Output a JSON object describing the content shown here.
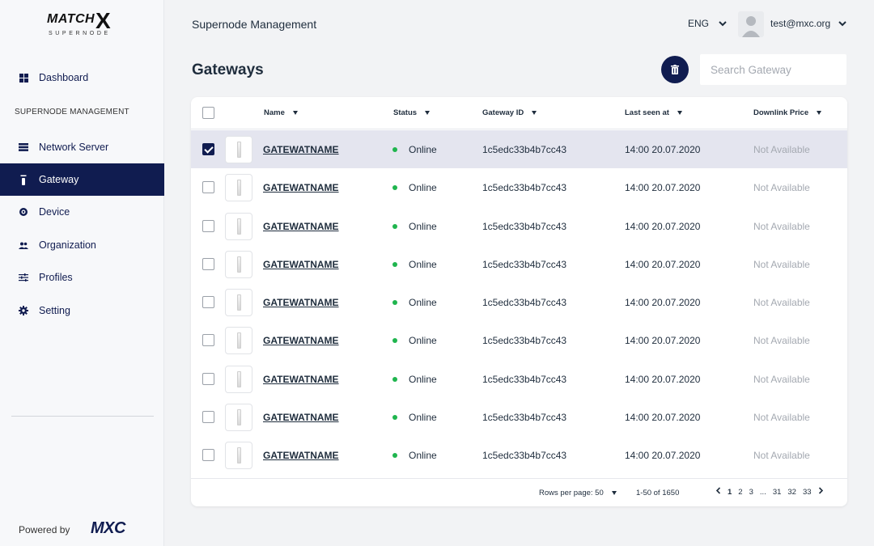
{
  "sidebar": {
    "logo_word": "MATCH",
    "logo_x": "X",
    "logo_sub": "SUPERNODE",
    "section_label": "SUPERNODE MANAGEMENT",
    "items": [
      {
        "label": "Dashboard",
        "icon": "grid-icon"
      },
      {
        "label": "Network Server",
        "icon": "server-icon"
      },
      {
        "label": "Gateway",
        "icon": "gateway-icon",
        "active": true
      },
      {
        "label": "Device",
        "icon": "device-icon"
      },
      {
        "label": "Organization",
        "icon": "people-icon"
      },
      {
        "label": "Profiles",
        "icon": "sliders-icon"
      },
      {
        "label": "Setting",
        "icon": "gear-icon"
      }
    ],
    "powered_by": "Powered by",
    "powered_logo": "MXC"
  },
  "header": {
    "title": "Supernode Management",
    "language": "ENG",
    "user_email": "test@mxc.org"
  },
  "main": {
    "title": "Gateways",
    "search_placeholder": "Search Gateway"
  },
  "table": {
    "columns": [
      "Name",
      "Status",
      "Gateway ID",
      "Last seen at",
      "Downlink Price"
    ],
    "rows": [
      {
        "name": "GATEWATNAME",
        "status": "Online",
        "gateway_id": "1c5edc33b4b7cc43",
        "last_seen": "14:00 20.07.2020",
        "price": "Not Available",
        "selected": true
      },
      {
        "name": "GATEWATNAME",
        "status": "Online",
        "gateway_id": "1c5edc33b4b7cc43",
        "last_seen": "14:00 20.07.2020",
        "price": "Not Available",
        "selected": false
      },
      {
        "name": "GATEWATNAME",
        "status": "Online",
        "gateway_id": "1c5edc33b4b7cc43",
        "last_seen": "14:00 20.07.2020",
        "price": "Not Available",
        "selected": false
      },
      {
        "name": "GATEWATNAME",
        "status": "Online",
        "gateway_id": "1c5edc33b4b7cc43",
        "last_seen": "14:00 20.07.2020",
        "price": "Not Available",
        "selected": false
      },
      {
        "name": "GATEWATNAME",
        "status": "Online",
        "gateway_id": "1c5edc33b4b7cc43",
        "last_seen": "14:00 20.07.2020",
        "price": "Not Available",
        "selected": false
      },
      {
        "name": "GATEWATNAME",
        "status": "Online",
        "gateway_id": "1c5edc33b4b7cc43",
        "last_seen": "14:00 20.07.2020",
        "price": "Not Available",
        "selected": false
      },
      {
        "name": "GATEWATNAME",
        "status": "Online",
        "gateway_id": "1c5edc33b4b7cc43",
        "last_seen": "14:00 20.07.2020",
        "price": "Not Available",
        "selected": false
      },
      {
        "name": "GATEWATNAME",
        "status": "Online",
        "gateway_id": "1c5edc33b4b7cc43",
        "last_seen": "14:00 20.07.2020",
        "price": "Not Available",
        "selected": false
      },
      {
        "name": "GATEWATNAME",
        "status": "Online",
        "gateway_id": "1c5edc33b4b7cc43",
        "last_seen": "14:00 20.07.2020",
        "price": "Not Available",
        "selected": false
      }
    ],
    "pagination": {
      "rows_per_page": "Rows per page: 50",
      "range": "1-50 of 1650",
      "pages": [
        "1",
        "2",
        "3",
        "...",
        "31",
        "32",
        "33"
      ],
      "current": "1"
    }
  },
  "colors": {
    "accent": "#101c50",
    "online": "#1fb54e",
    "muted": "#a4a9b1"
  }
}
